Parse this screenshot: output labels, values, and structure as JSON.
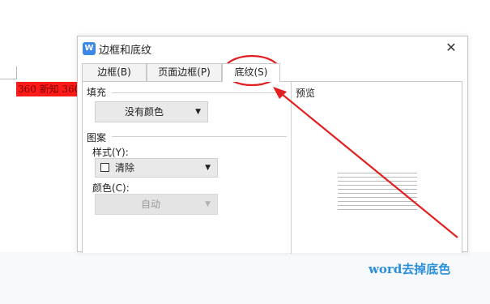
{
  "background": {
    "highlight_text": "360 新知 360"
  },
  "dialog": {
    "title": "边框和底纹",
    "app_icon_glyph": "W",
    "close_glyph": "✕",
    "tabs": [
      {
        "label": "边框(B)",
        "active": false
      },
      {
        "label": "页面边框(P)",
        "active": false
      },
      {
        "label": "底纹(S)",
        "active": true
      }
    ],
    "fill": {
      "section_label": "填充",
      "button_label": "没有颜色",
      "arrow": "▼"
    },
    "pattern": {
      "section_label": "图案",
      "style_label": "样式(Y):",
      "style_value": "清除",
      "color_label": "颜色(C):",
      "color_value": "自动",
      "arrow": "▼"
    },
    "preview": {
      "label": "预览"
    }
  },
  "caption": "word去掉底色",
  "colors": {
    "highlight": "#ff1a1a",
    "annotation": "#e32020",
    "caption": "#2a8fd8",
    "app_icon": "#3b88e6"
  }
}
